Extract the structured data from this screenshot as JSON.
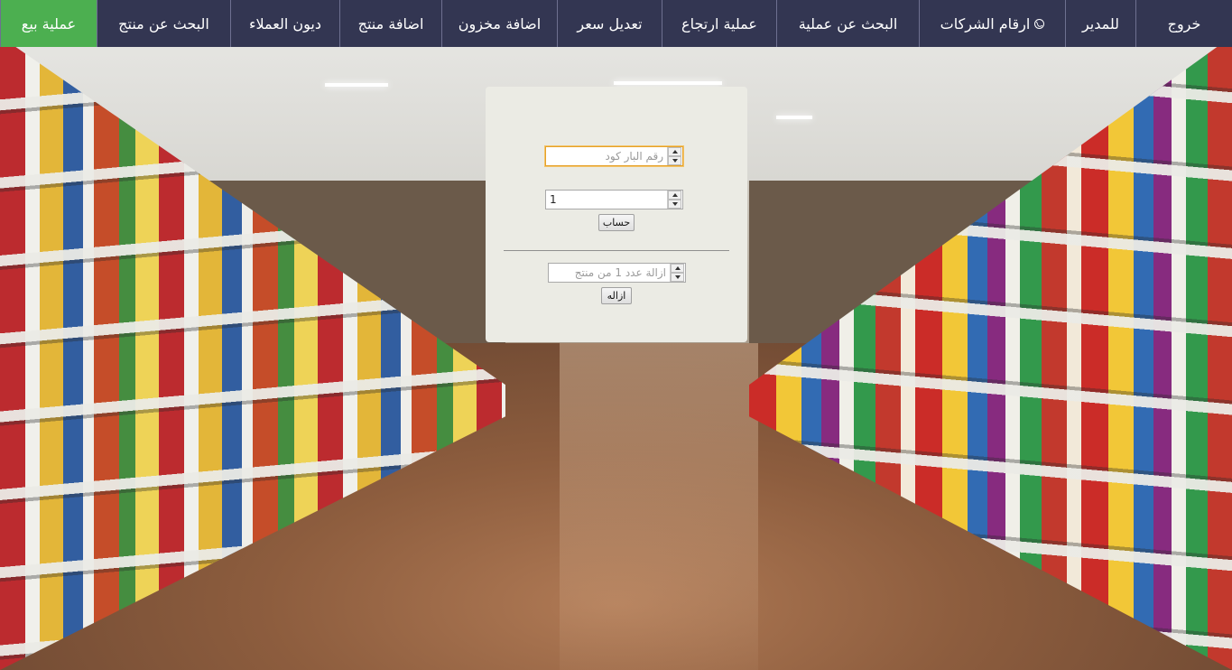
{
  "nav": {
    "items": [
      {
        "label": "عملية بيع",
        "active": true
      },
      {
        "label": "البحث عن منتج"
      },
      {
        "label": "ديون العملاء"
      },
      {
        "label": "اضافة منتج"
      },
      {
        "label": "اضافة مخزون"
      },
      {
        "label": "تعديل سعر"
      },
      {
        "label": "عملية ارتجاع"
      },
      {
        "label": "البحث عن عملية"
      },
      {
        "label": "ارقام الشركات",
        "icon": "phone-icon"
      },
      {
        "label": "للمدير"
      },
      {
        "label": "خروج"
      }
    ],
    "active_color": "#4caf50",
    "bar_color": "#333652"
  },
  "form": {
    "barcode": {
      "value": "",
      "placeholder": "رقم البار كود"
    },
    "quantity": {
      "value": "1"
    },
    "calc_button": "حساب",
    "remove_qty": {
      "value": "",
      "placeholder": "ازالة عدد 1 من منتج"
    },
    "remove_button": "ازاله"
  },
  "background": {
    "subject": "supermarket-aisle"
  }
}
